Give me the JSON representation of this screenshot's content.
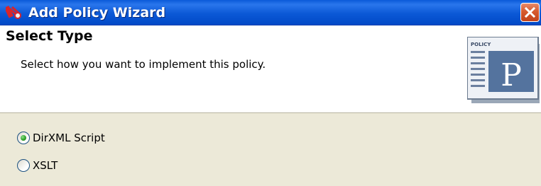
{
  "window": {
    "title": "Add Policy Wizard",
    "app_icon": "wizard-app-icon",
    "close_icon": "close-x-icon",
    "colors": {
      "titlebar": "#0b58d6",
      "close": "#d65a2f",
      "panel": "#ece9d8",
      "header_bg": "#ffffff"
    }
  },
  "header": {
    "heading": "Select Type",
    "subtitle": "Select how you want to implement this policy.",
    "graphic": {
      "icon": "policy-document-icon",
      "doc_label": "POLICY",
      "letter": "P"
    }
  },
  "options": [
    {
      "label": "DirXML Script",
      "selected": true
    },
    {
      "label": "XSLT",
      "selected": false
    }
  ]
}
